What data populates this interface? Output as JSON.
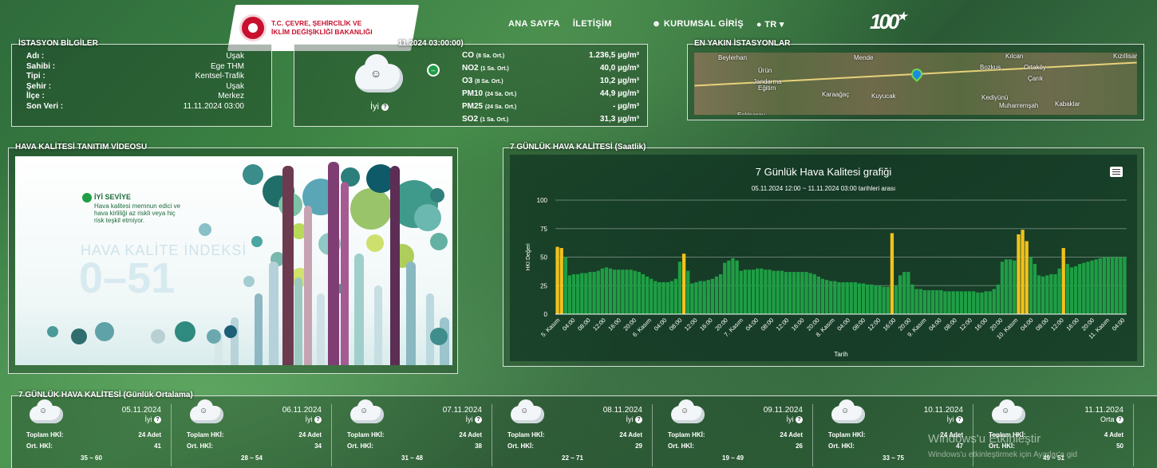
{
  "header": {
    "ministry_line1": "T.C. ÇEVRE, ŞEHİRCİLİK VE",
    "ministry_line2": "İKLİM DEĞİŞİKLİĞİ BAKANLIĞI",
    "nav": [
      "ANA SAYFA",
      "İLETİŞİM",
      "KURUMSAL GİRİŞ",
      "TR"
    ],
    "logo_100": "100"
  },
  "station": {
    "title": "İSTASYON BİLGİLER",
    "rows": [
      {
        "k": "Adı :",
        "v": "Uşak"
      },
      {
        "k": "Sahibi :",
        "v": "Ege THM"
      },
      {
        "k": "Tipi :",
        "v": "Kentsel-Trafik"
      },
      {
        "k": "Şehir :",
        "v": "Uşak"
      },
      {
        "k": "İlçe :",
        "v": "Merkez"
      },
      {
        "k": "Son Veri :",
        "v": "11.11.2024 03:00"
      }
    ]
  },
  "current": {
    "title": "11.2024 03:00:00)",
    "status": "İyi",
    "pollutants": [
      {
        "name": "CO",
        "avg": "(8 Sa. Ort.)",
        "value": "1.236,5 µg/m³"
      },
      {
        "name": "NO2",
        "avg": "(1 Sa. Ort.)",
        "value": "40,0 µg/m³"
      },
      {
        "name": "O3",
        "avg": "(8 Sa. Ort.)",
        "value": "10,2 µg/m³"
      },
      {
        "name": "PM10",
        "avg": "(24 Sa. Ort.)",
        "value": "44,9 µg/m³"
      },
      {
        "name": "PM25",
        "avg": "(24 Sa. Ort.)",
        "value": "- µg/m³"
      },
      {
        "name": "SO2",
        "avg": "(1 Sa. Ort.)",
        "value": "31,3 µg/m³"
      }
    ]
  },
  "nearest": {
    "title": "EN YAKIN İSTASYONLAR",
    "towns": [
      "Beylerhan",
      "Mende",
      "Kılcan",
      "Kızıllisar",
      "Ürün",
      "Bozkuş",
      "Ortaköy",
      "Jandarma",
      "Eğitim",
      "Çarık",
      "Karaağaç",
      "Kuyucak",
      "Kediyünü",
      "Muharremşah",
      "Kabaklar",
      "Eskisaray"
    ]
  },
  "video": {
    "title": "HAVA KALİTESİ TANITIM VİDEOSU",
    "level_title": "İYİ SEVİYE",
    "level_desc": "Hava kalitesi memnun edici ve hava kirliliği az riskli veya hiç risk teşkil etmiyor.",
    "index_label": "HAVA KALİTE İNDEKSİ",
    "index_range": "0–51"
  },
  "weekly": {
    "title": "7 GÜNLÜK HAVA KALİTESİ (Saatlik)",
    "chart_title": "7 Günlük Hava Kalitesi grafiği",
    "chart_subtitle": "05.11.2024 12:00 ~ 11.11.2024 03:00 tarihleri arası",
    "xlabel": "Tarih",
    "ylabel": "HKI Değeri"
  },
  "chart_data": {
    "type": "bar",
    "title": "7 Günlük Hava Kalitesi grafiği",
    "subtitle": "05.11.2024 12:00 ~ 11.11.2024 03:00 tarihleri arası",
    "xlabel": "Tarih",
    "ylabel": "HKI Değeri",
    "ylim": [
      0,
      100
    ],
    "yticks": [
      0,
      25,
      50,
      75,
      100
    ],
    "xticks": [
      "5. Kasım",
      "04:00",
      "08:00",
      "12:00",
      "16:00",
      "20:00",
      "6. Kasım",
      "04:00",
      "08:00",
      "12:00",
      "16:00",
      "20:00",
      "7. Kasım",
      "04:00",
      "08:00",
      "12:00",
      "16:00",
      "20:00",
      "8. Kasım",
      "04:00",
      "08:00",
      "12:00",
      "16:00",
      "20:00",
      "9. Kasım",
      "04:00",
      "08:00",
      "12:00",
      "16:00",
      "20:00",
      "10. Kasım",
      "04:00",
      "08:00",
      "12:00",
      "16:00",
      "20:00",
      "11. Kasım",
      "04:00"
    ],
    "colors": {
      "good": "#1f9e45",
      "moderate": "#f2c21b"
    },
    "values": [
      59,
      58,
      50,
      34,
      35,
      35,
      36,
      36,
      37,
      37,
      38,
      40,
      41,
      40,
      39,
      39,
      39,
      39,
      39,
      38,
      37,
      35,
      33,
      31,
      29,
      28,
      28,
      28,
      29,
      31,
      46,
      53,
      38,
      27,
      28,
      29,
      29,
      30,
      31,
      33,
      35,
      45,
      47,
      49,
      47,
      38,
      39,
      39,
      39,
      40,
      40,
      39,
      39,
      38,
      38,
      38,
      37,
      37,
      37,
      37,
      37,
      37,
      36,
      35,
      33,
      31,
      30,
      29,
      29,
      28,
      28,
      28,
      28,
      28,
      27,
      27,
      26,
      26,
      25,
      25,
      24,
      24,
      71,
      25,
      34,
      37,
      37,
      26,
      22,
      22,
      21,
      21,
      21,
      21,
      21,
      20,
      20,
      20,
      20,
      20,
      20,
      20,
      20,
      19,
      19,
      20,
      20,
      22,
      26,
      46,
      48,
      48,
      47,
      70,
      74,
      64,
      50,
      44,
      34,
      33,
      34,
      35,
      35,
      40,
      58,
      44,
      41,
      42,
      44,
      45,
      46,
      47,
      48,
      49,
      50,
      50,
      50,
      50,
      50,
      50
    ]
  },
  "daily": {
    "title": "7 GÜNLÜK HAVA KALİTESİ (Günlük Ortalama)",
    "label_total": "Toplam HKİ:",
    "label_avg": "Ort. HKİ:",
    "days": [
      {
        "date": "05.11.2024",
        "status": "İyi",
        "total": "24 Adet",
        "avg": "41",
        "range": "35 ~ 60"
      },
      {
        "date": "06.11.2024",
        "status": "İyi",
        "total": "24 Adet",
        "avg": "34",
        "range": "28 ~ 54"
      },
      {
        "date": "07.11.2024",
        "status": "İyi",
        "total": "24 Adet",
        "avg": "38",
        "range": "31 ~ 48"
      },
      {
        "date": "08.11.2024",
        "status": "İyi",
        "total": "24 Adet",
        "avg": "29",
        "range": "22 ~ 71"
      },
      {
        "date": "09.11.2024",
        "status": "İyi",
        "total": "24 Adet",
        "avg": "26",
        "range": "19 ~ 49"
      },
      {
        "date": "10.11.2024",
        "status": "İyi",
        "total": "24 Adet",
        "avg": "47",
        "range": "33 ~ 75"
      },
      {
        "date": "11.11.2024",
        "status": "Orta",
        "total": "4 Adet",
        "avg": "50",
        "range": "49 ~ 51"
      }
    ]
  },
  "watermark": {
    "line1": "Windows'u Etkinleştir",
    "line2": "Windows'u etkinleştirmek için Ayarlar'a gid"
  }
}
